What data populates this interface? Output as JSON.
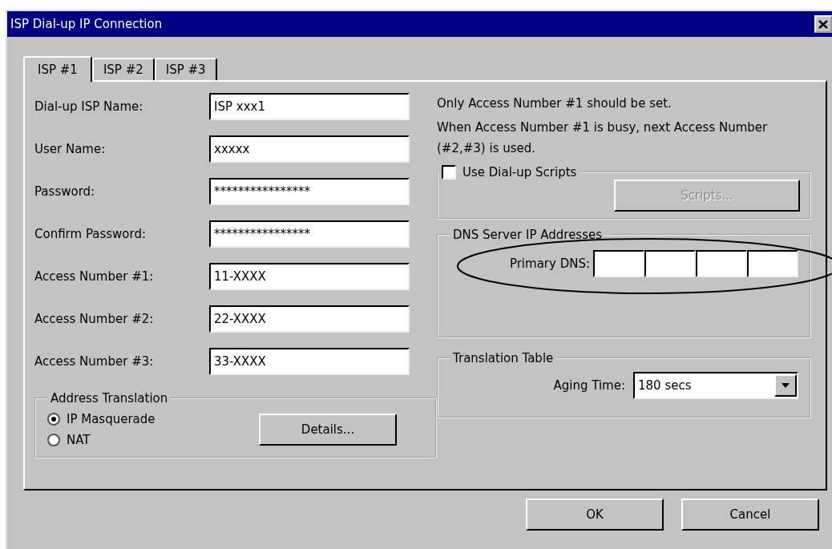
{
  "window": {
    "title": "ISP Dial-up IP Connection"
  },
  "tabs": [
    {
      "label": "ISP #1",
      "selected": true
    },
    {
      "label": "ISP #2",
      "selected": false
    },
    {
      "label": "ISP #3",
      "selected": false
    }
  ],
  "fields": [
    {
      "label": "Dial-up ISP Name:",
      "value": "ISP xxx1"
    },
    {
      "label": "User Name:",
      "value": "xxxxx"
    },
    {
      "label": "Password:",
      "value": "****************"
    },
    {
      "label": "Confirm Password:",
      "value": "****************"
    },
    {
      "label": "Access Number #1:",
      "value": "11-XXXX"
    },
    {
      "label": "Access Number #2:",
      "value": "22-XXXX"
    },
    {
      "label": "Access Number #3:",
      "value": "33-XXXX"
    }
  ],
  "notes": [
    "Only Access Number #1 should be set.",
    "When Access Number #1 is busy, next Access Number (#2,#3) is used."
  ],
  "scripts": {
    "label": "Use Dial-up Scripts",
    "checked": false,
    "button": {
      "label": "Scripts...",
      "disabled": true
    }
  },
  "dns": {
    "title": "DNS Server IP Addresses",
    "label": "Primary DNS:"
  },
  "address_translation": {
    "title": "Address Translation",
    "options": [
      {
        "label": "IP Masquerade",
        "selected": true
      },
      {
        "label": "NAT",
        "selected": false
      }
    ],
    "button": "Details..."
  },
  "translation_table": {
    "title": "Translation Table",
    "label": "Aging Time:",
    "value": "180 secs"
  },
  "buttons": [
    "OK",
    "Cancel"
  ]
}
